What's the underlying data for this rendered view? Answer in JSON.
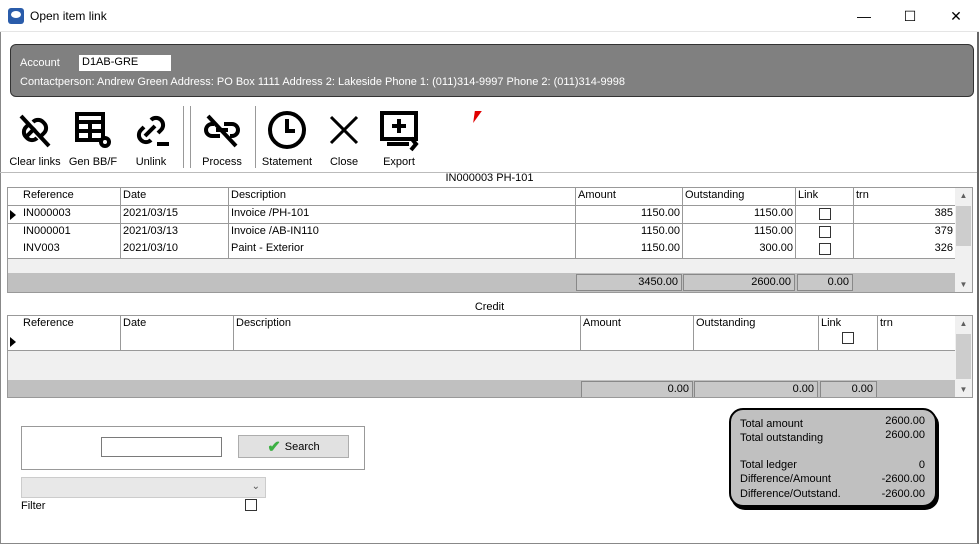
{
  "window": {
    "title": "Open item link",
    "minimize": "—",
    "maximize": "☐",
    "close": "✕"
  },
  "header": {
    "account_label": "Account",
    "account_value": "D1AB-GRE",
    "contact_line": "Contactperson: Andrew Green Address: PO Box 1111 Address 2: Lakeside Phone 1: (011)314-9997 Phone 2: (011)314-9998"
  },
  "toolbar": {
    "clear_links": "Clear links",
    "gen_bbf": "Gen BB/F",
    "unlink": "Unlink",
    "process": "Process",
    "statement": "Statement",
    "close": "Close",
    "export": "Export"
  },
  "debit": {
    "title": "IN000003 PH-101",
    "columns": [
      "Reference",
      "Date",
      "Description",
      "Amount",
      "Outstanding",
      "Link",
      "trn"
    ],
    "rows": [
      {
        "ref": "IN000003",
        "date": "2021/03/15",
        "desc": "Invoice /PH-101",
        "amount": "1150.00",
        "outstanding": "1150.00",
        "link": false,
        "trn": "385"
      },
      {
        "ref": "IN000001",
        "date": "2021/03/13",
        "desc": "Invoice /AB-IN110",
        "amount": "1150.00",
        "outstanding": "1150.00",
        "link": false,
        "trn": "379"
      },
      {
        "ref": "INV003",
        "date": "2021/03/10",
        "desc": "Paint - Exterior",
        "amount": "1150.00",
        "outstanding": "300.00",
        "link": false,
        "trn": "326"
      }
    ],
    "totals": {
      "amount": "3450.00",
      "outstanding": "2600.00",
      "link": "0.00"
    }
  },
  "credit": {
    "title": "Credit",
    "columns": [
      "Reference",
      "Date",
      "Description",
      "Amount",
      "Outstanding",
      "Link",
      "trn"
    ],
    "totals": {
      "amount": "0.00",
      "outstanding": "0.00",
      "link": "0.00"
    }
  },
  "search": {
    "input_value": "",
    "button_label": "Search"
  },
  "filter": {
    "dropdown_value": "",
    "label": "Filter",
    "checked": false
  },
  "summary": {
    "total_amount_label": "Total amount",
    "total_amount": "2600.00",
    "total_outstanding_label": "Total outstanding",
    "total_outstanding": "2600.00",
    "total_ledger_label": "Total ledger",
    "total_ledger": "0",
    "diff_amount_label": "Difference/Amount",
    "diff_amount": "-2600.00",
    "diff_outstand_label": "Difference/Outstand.",
    "diff_outstand": "-2600.00"
  },
  "colors": {
    "header_bg": "#808080",
    "summary_bg": "#c0c0c0",
    "cursor": "#e00000"
  }
}
